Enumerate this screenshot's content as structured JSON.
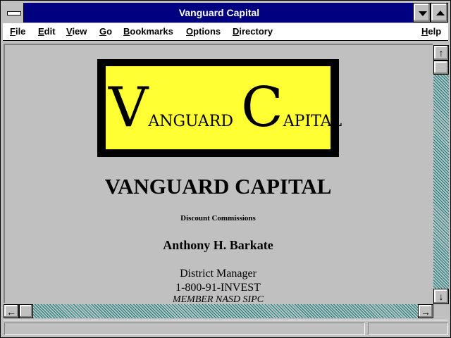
{
  "window": {
    "title": "Vanguard Capital"
  },
  "menu": {
    "items": [
      {
        "label": "File",
        "key": "F"
      },
      {
        "label": "Edit",
        "key": "E"
      },
      {
        "label": "View",
        "key": "V"
      },
      {
        "label": "Go",
        "key": "G"
      },
      {
        "label": "Bookmarks",
        "key": "B"
      },
      {
        "label": "Options",
        "key": "O"
      },
      {
        "label": "Directory",
        "key": "D"
      },
      {
        "label": "Help",
        "key": "H"
      }
    ]
  },
  "page": {
    "logo": {
      "first_cap": "V",
      "first_rest": "ANGUARD",
      "second_cap": "C",
      "second_rest": "APITAL"
    },
    "title": "VANGUARD CAPITAL",
    "subtitle": "Discount Commissions",
    "name": "Anthony H. Barkate",
    "position": "District Manager",
    "phone": "1-800-91-INVEST",
    "member": "MEMBER NASD SIPC"
  },
  "icons": {
    "system_menu": "system-menu-icon",
    "minimize": "minimize-icon",
    "maximize": "maximize-icon",
    "scroll_up": "arrow-up-icon",
    "scroll_down": "arrow-down-icon",
    "scroll_left": "arrow-left-icon",
    "scroll_right": "arrow-right-icon"
  },
  "colors": {
    "titlebar": "#000080",
    "logo_bg": "#ffff33",
    "scroll_track": "#008080",
    "chrome": "#c0c0c0"
  }
}
